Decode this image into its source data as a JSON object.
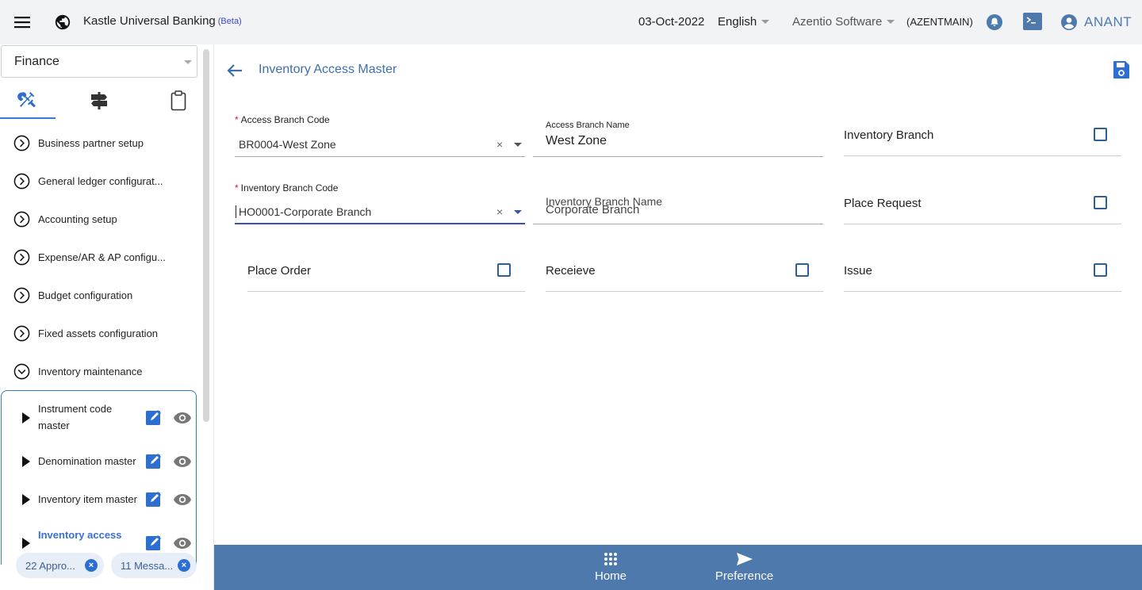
{
  "header": {
    "app_name": "Kastle Universal Banking",
    "beta_label": "(Beta)",
    "date": "03-Oct-2022",
    "language": "English",
    "company": "Azentio Software",
    "entity_code": "(AZENTMAIN)",
    "user_name": "ANANT"
  },
  "sidebar": {
    "module": "Finance",
    "tabs": [
      {
        "icon": "tools-icon",
        "active": true
      },
      {
        "icon": "signpost-icon",
        "active": false
      },
      {
        "icon": "clipboard-icon",
        "active": false
      }
    ],
    "menu": [
      {
        "label": "Business partner setup",
        "expanded": false
      },
      {
        "label": "General ledger configurat...",
        "expanded": false
      },
      {
        "label": "Accounting setup",
        "expanded": false
      },
      {
        "label": "Expense/AR & AP configu...",
        "expanded": false
      },
      {
        "label": "Budget configuration",
        "expanded": false
      },
      {
        "label": "Fixed assets configuration",
        "expanded": false
      },
      {
        "label": "Inventory maintenance",
        "expanded": true
      }
    ],
    "submenu": [
      {
        "label": "Instrument code master",
        "active": false
      },
      {
        "label": "Denomination master",
        "active": false
      },
      {
        "label": "Inventory item master",
        "active": false
      },
      {
        "label": "Inventory access",
        "active": true
      }
    ],
    "chips": [
      {
        "label": "22 Appro..."
      },
      {
        "label": "11 Messa..."
      }
    ]
  },
  "page": {
    "title": "Inventory Access Master",
    "fields": {
      "access_branch_code": {
        "label": "Access Branch Code",
        "required": true,
        "value": "BR0004-West Zone"
      },
      "access_branch_name": {
        "label": "Access Branch Name",
        "value": "West Zone"
      },
      "inventory_branch": {
        "label": "Inventory Branch",
        "checked": false
      },
      "inventory_branch_code": {
        "label": "Inventory Branch Code",
        "required": true,
        "value": "HO0001-Corporate Branch"
      },
      "inventory_branch_name": {
        "label": "Inventory Branch Name",
        "value": "Corporate Branch"
      },
      "place_request": {
        "label": "Place Request",
        "checked": false
      },
      "place_order": {
        "label": "Place Order",
        "checked": false
      },
      "receive": {
        "label": "Receieve",
        "checked": false
      },
      "issue": {
        "label": "Issue",
        "checked": false
      }
    },
    "required_marker": "*",
    "clear_symbol": "×"
  },
  "bottom_nav": {
    "home": "Home",
    "preference": "Preference"
  },
  "colors": {
    "accent": "#3a7bd5",
    "title": "#3f6fa8",
    "bottom_bar": "#4d79ad",
    "checkbox_border": "#2e5f96"
  }
}
